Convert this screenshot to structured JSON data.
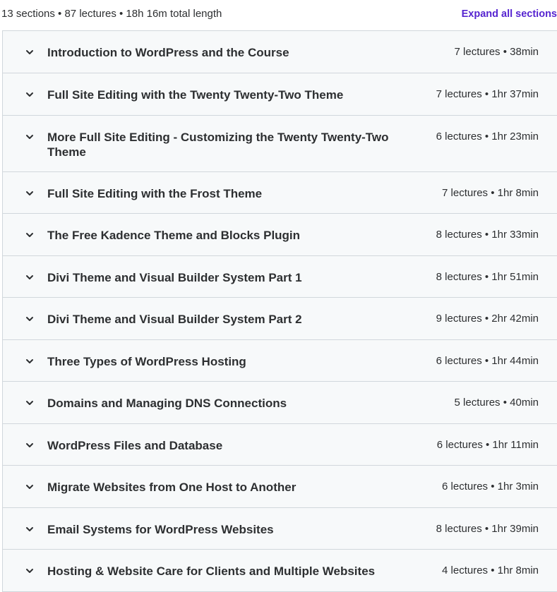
{
  "header": {
    "summary": "13 sections • 87 lectures • 18h 16m total length",
    "expand_all_label": "Expand all sections"
  },
  "sections": [
    {
      "title": "Introduction to WordPress and the Course",
      "meta": "7 lectures • 38min"
    },
    {
      "title": "Full Site Editing with the Twenty Twenty-Two Theme",
      "meta": "7 lectures • 1hr 37min"
    },
    {
      "title": "More Full Site Editing - Customizing the Twenty Twenty-Two Theme",
      "meta": "6 lectures • 1hr 23min"
    },
    {
      "title": "Full Site Editing with the Frost Theme",
      "meta": "7 lectures • 1hr 8min"
    },
    {
      "title": "The Free Kadence Theme and Blocks Plugin",
      "meta": "8 lectures • 1hr 33min"
    },
    {
      "title": "Divi Theme and Visual Builder System Part 1",
      "meta": "8 lectures • 1hr 51min"
    },
    {
      "title": "Divi Theme and Visual Builder System Part 2",
      "meta": "9 lectures • 2hr 42min"
    },
    {
      "title": "Three Types of WordPress Hosting",
      "meta": "6 lectures • 1hr 44min"
    },
    {
      "title": "Domains and Managing DNS Connections",
      "meta": "5 lectures • 40min"
    },
    {
      "title": "WordPress Files and Database",
      "meta": "6 lectures • 1hr 11min"
    },
    {
      "title": "Migrate Websites from One Host to Another",
      "meta": "6 lectures • 1hr 3min"
    },
    {
      "title": "Email Systems for WordPress Websites",
      "meta": "8 lectures • 1hr 39min"
    },
    {
      "title": "Hosting & Website Care for Clients and Multiple Websites",
      "meta": "4 lectures • 1hr 8min"
    }
  ],
  "colors": {
    "accent": "#5624d0",
    "section_bg": "#f7f9fa",
    "border": "#d1d7dc",
    "text": "#2d2f31"
  },
  "icons": {
    "section_toggle": "chevron-down-icon"
  }
}
